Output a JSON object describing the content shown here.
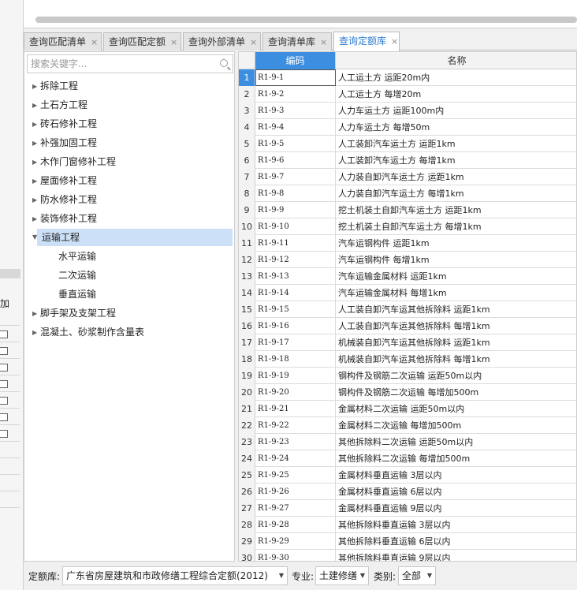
{
  "left_panel": {
    "add_label": "加"
  },
  "search": {
    "placeholder": "搜索关键字..."
  },
  "tabs": [
    {
      "label": "查询匹配清单",
      "active": false
    },
    {
      "label": "查询匹配定额",
      "active": false
    },
    {
      "label": "查询外部清单",
      "active": false
    },
    {
      "label": "查询清单库",
      "active": false
    },
    {
      "label": "查询定额库",
      "active": true
    }
  ],
  "tab_close": "×",
  "tree": [
    {
      "label": "拆除工程",
      "level": 0,
      "expanded": false
    },
    {
      "label": "土石方工程",
      "level": 0,
      "expanded": false
    },
    {
      "label": "砖石修补工程",
      "level": 0,
      "expanded": false
    },
    {
      "label": "补强加固工程",
      "level": 0,
      "expanded": false
    },
    {
      "label": "木作门窗修补工程",
      "level": 0,
      "expanded": false
    },
    {
      "label": "屋面修补工程",
      "level": 0,
      "expanded": false
    },
    {
      "label": "防水修补工程",
      "level": 0,
      "expanded": false
    },
    {
      "label": "装饰修补工程",
      "level": 0,
      "expanded": false
    },
    {
      "label": "运输工程",
      "level": 0,
      "expanded": true,
      "selected": true
    },
    {
      "label": "水平运输",
      "level": 1
    },
    {
      "label": "二次运输",
      "level": 1
    },
    {
      "label": "垂直运输",
      "level": 1
    },
    {
      "label": "脚手架及支架工程",
      "level": 0,
      "expanded": false
    },
    {
      "label": "混凝土、砂浆制作含量表",
      "level": 0,
      "expanded": false
    }
  ],
  "grid": {
    "headers": {
      "code": "编码",
      "name": "名称"
    },
    "rows": [
      {
        "num": "1",
        "code": "R1-9-1",
        "name": "人工运土方 运距20m内"
      },
      {
        "num": "2",
        "code": "R1-9-2",
        "name": "人工运土方 每增20m"
      },
      {
        "num": "3",
        "code": "R1-9-3",
        "name": "人力车运土方 运距100m内"
      },
      {
        "num": "4",
        "code": "R1-9-4",
        "name": "人力车运土方 每增50m"
      },
      {
        "num": "5",
        "code": "R1-9-5",
        "name": "人工装卸汽车运土方 运距1km"
      },
      {
        "num": "6",
        "code": "R1-9-6",
        "name": "人工装卸汽车运土方 每增1km"
      },
      {
        "num": "7",
        "code": "R1-9-7",
        "name": "人力装自卸汽车运土方 运距1km"
      },
      {
        "num": "8",
        "code": "R1-9-8",
        "name": "人力装自卸汽车运土方 每增1km"
      },
      {
        "num": "9",
        "code": "R1-9-9",
        "name": "挖土机装土自卸汽车运土方 运距1km"
      },
      {
        "num": "10",
        "code": "R1-9-10",
        "name": "挖土机装土自卸汽车运土方 每增1km"
      },
      {
        "num": "11",
        "code": "R1-9-11",
        "name": "汽车运钢构件 运距1km"
      },
      {
        "num": "12",
        "code": "R1-9-12",
        "name": "汽车运钢构件 每增1km"
      },
      {
        "num": "13",
        "code": "R1-9-13",
        "name": "汽车运输金属材料 运距1km"
      },
      {
        "num": "14",
        "code": "R1-9-14",
        "name": "汽车运输金属材料 每增1km"
      },
      {
        "num": "15",
        "code": "R1-9-15",
        "name": "人工装自卸汽车运其他拆除料 运距1km"
      },
      {
        "num": "16",
        "code": "R1-9-16",
        "name": "人工装自卸汽车运其他拆除料 每增1km"
      },
      {
        "num": "17",
        "code": "R1-9-17",
        "name": "机械装自卸汽车运其他拆除料 运距1km"
      },
      {
        "num": "18",
        "code": "R1-9-18",
        "name": "机械装自卸汽车运其他拆除料 每增1km"
      },
      {
        "num": "19",
        "code": "R1-9-19",
        "name": "钢构件及钢筋二次运输 运距50m以内"
      },
      {
        "num": "20",
        "code": "R1-9-20",
        "name": "钢构件及钢筋二次运输 每增加500m"
      },
      {
        "num": "21",
        "code": "R1-9-21",
        "name": "金属材料二次运输 运距50m以内"
      },
      {
        "num": "22",
        "code": "R1-9-22",
        "name": "金属材料二次运输 每增加500m"
      },
      {
        "num": "23",
        "code": "R1-9-23",
        "name": "其他拆除料二次运输 运距50m以内"
      },
      {
        "num": "24",
        "code": "R1-9-24",
        "name": "其他拆除料二次运输 每增加500m"
      },
      {
        "num": "25",
        "code": "R1-9-25",
        "name": "金属材料垂直运输 3层以内"
      },
      {
        "num": "26",
        "code": "R1-9-26",
        "name": "金属材料垂直运输 6层以内"
      },
      {
        "num": "27",
        "code": "R1-9-27",
        "name": "金属材料垂直运输 9层以内"
      },
      {
        "num": "28",
        "code": "R1-9-28",
        "name": "其他拆除料垂直运输 3层以内"
      },
      {
        "num": "29",
        "code": "R1-9-29",
        "name": "其他拆除料垂直运输 6层以内"
      },
      {
        "num": "30",
        "code": "R1-9-30",
        "name": "其他拆除料垂直运输 9层以内"
      }
    ]
  },
  "bottom": {
    "quota_label": "定额库:",
    "quota_value": "广东省房屋建筑和市政修缮工程综合定额(2012)",
    "major_label": "专业:",
    "major_value": "土建修缮",
    "category_label": "类别:",
    "category_value": "全部"
  }
}
